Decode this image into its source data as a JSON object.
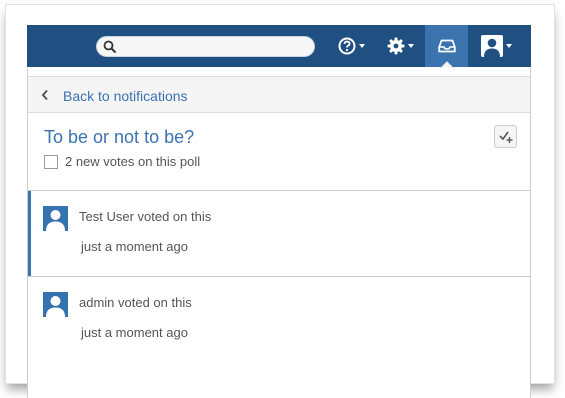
{
  "header": {
    "search": {
      "placeholder": "",
      "value": ""
    },
    "nav": [
      {
        "name": "help-menu",
        "icon": "help-icon"
      },
      {
        "name": "settings-menu",
        "icon": "gear-icon"
      },
      {
        "name": "notifications",
        "icon": "inbox-icon",
        "active": true
      },
      {
        "name": "user-menu",
        "icon": "user-icon"
      }
    ]
  },
  "panel": {
    "back_label": "Back to notifications",
    "title": "To be or not to be?",
    "subtitle": "2 new votes on this poll",
    "notifications": [
      {
        "text": "Test User voted on this",
        "time": "just a moment ago",
        "unread": true
      },
      {
        "text": "admin voted on this",
        "time": "just a moment ago",
        "unread": false
      }
    ]
  },
  "colors": {
    "header_bg": "#205081",
    "active_tab": "#3b73af",
    "link": "#3b73af",
    "avatar": "#3572b0"
  }
}
